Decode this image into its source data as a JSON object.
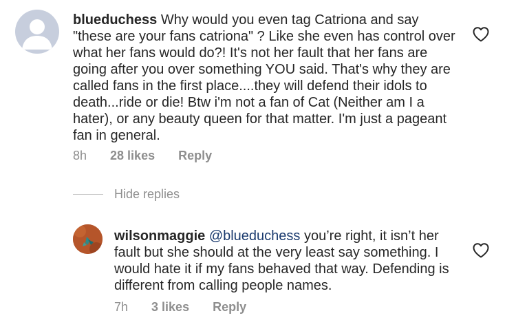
{
  "comments": [
    {
      "username": "blueduchess",
      "text": "Why would you even tag Catriona and say \"these are your fans catriona\" ? Like she even has control over what her fans would do?! It's not her fault that her fans are going after you over something YOU said. That's why they are called fans in the first place....they will defend their idols to death...ride or die! Btw i'm not a fan of Cat (Neither am I a hater), or any beauty queen for that matter. I'm just a pageant fan in general.",
      "time": "8h",
      "likes": "28 likes",
      "reply": "Reply",
      "avatar_icon": "default-avatar-icon",
      "heart_icon": "heart-outline-icon"
    }
  ],
  "hide_replies": "Hide replies",
  "reply": {
    "username": "wilsonmaggie",
    "mention": "@blueduchess",
    "text": "you’re right, it isn’t her fault but she should at the very least say something. I would hate it if my fans behaved that way. Defending is different from calling people names.",
    "time": "7h",
    "likes": "3 likes",
    "reply": "Reply",
    "avatar_icon": "profile-photo",
    "heart_icon": "heart-outline-icon"
  },
  "colors": {
    "text": "#262626",
    "meta": "#8e8e8e",
    "mention": "#1a3a6e",
    "avatar_default": "#c7cedd",
    "avatar_photo": "#b5552a"
  }
}
